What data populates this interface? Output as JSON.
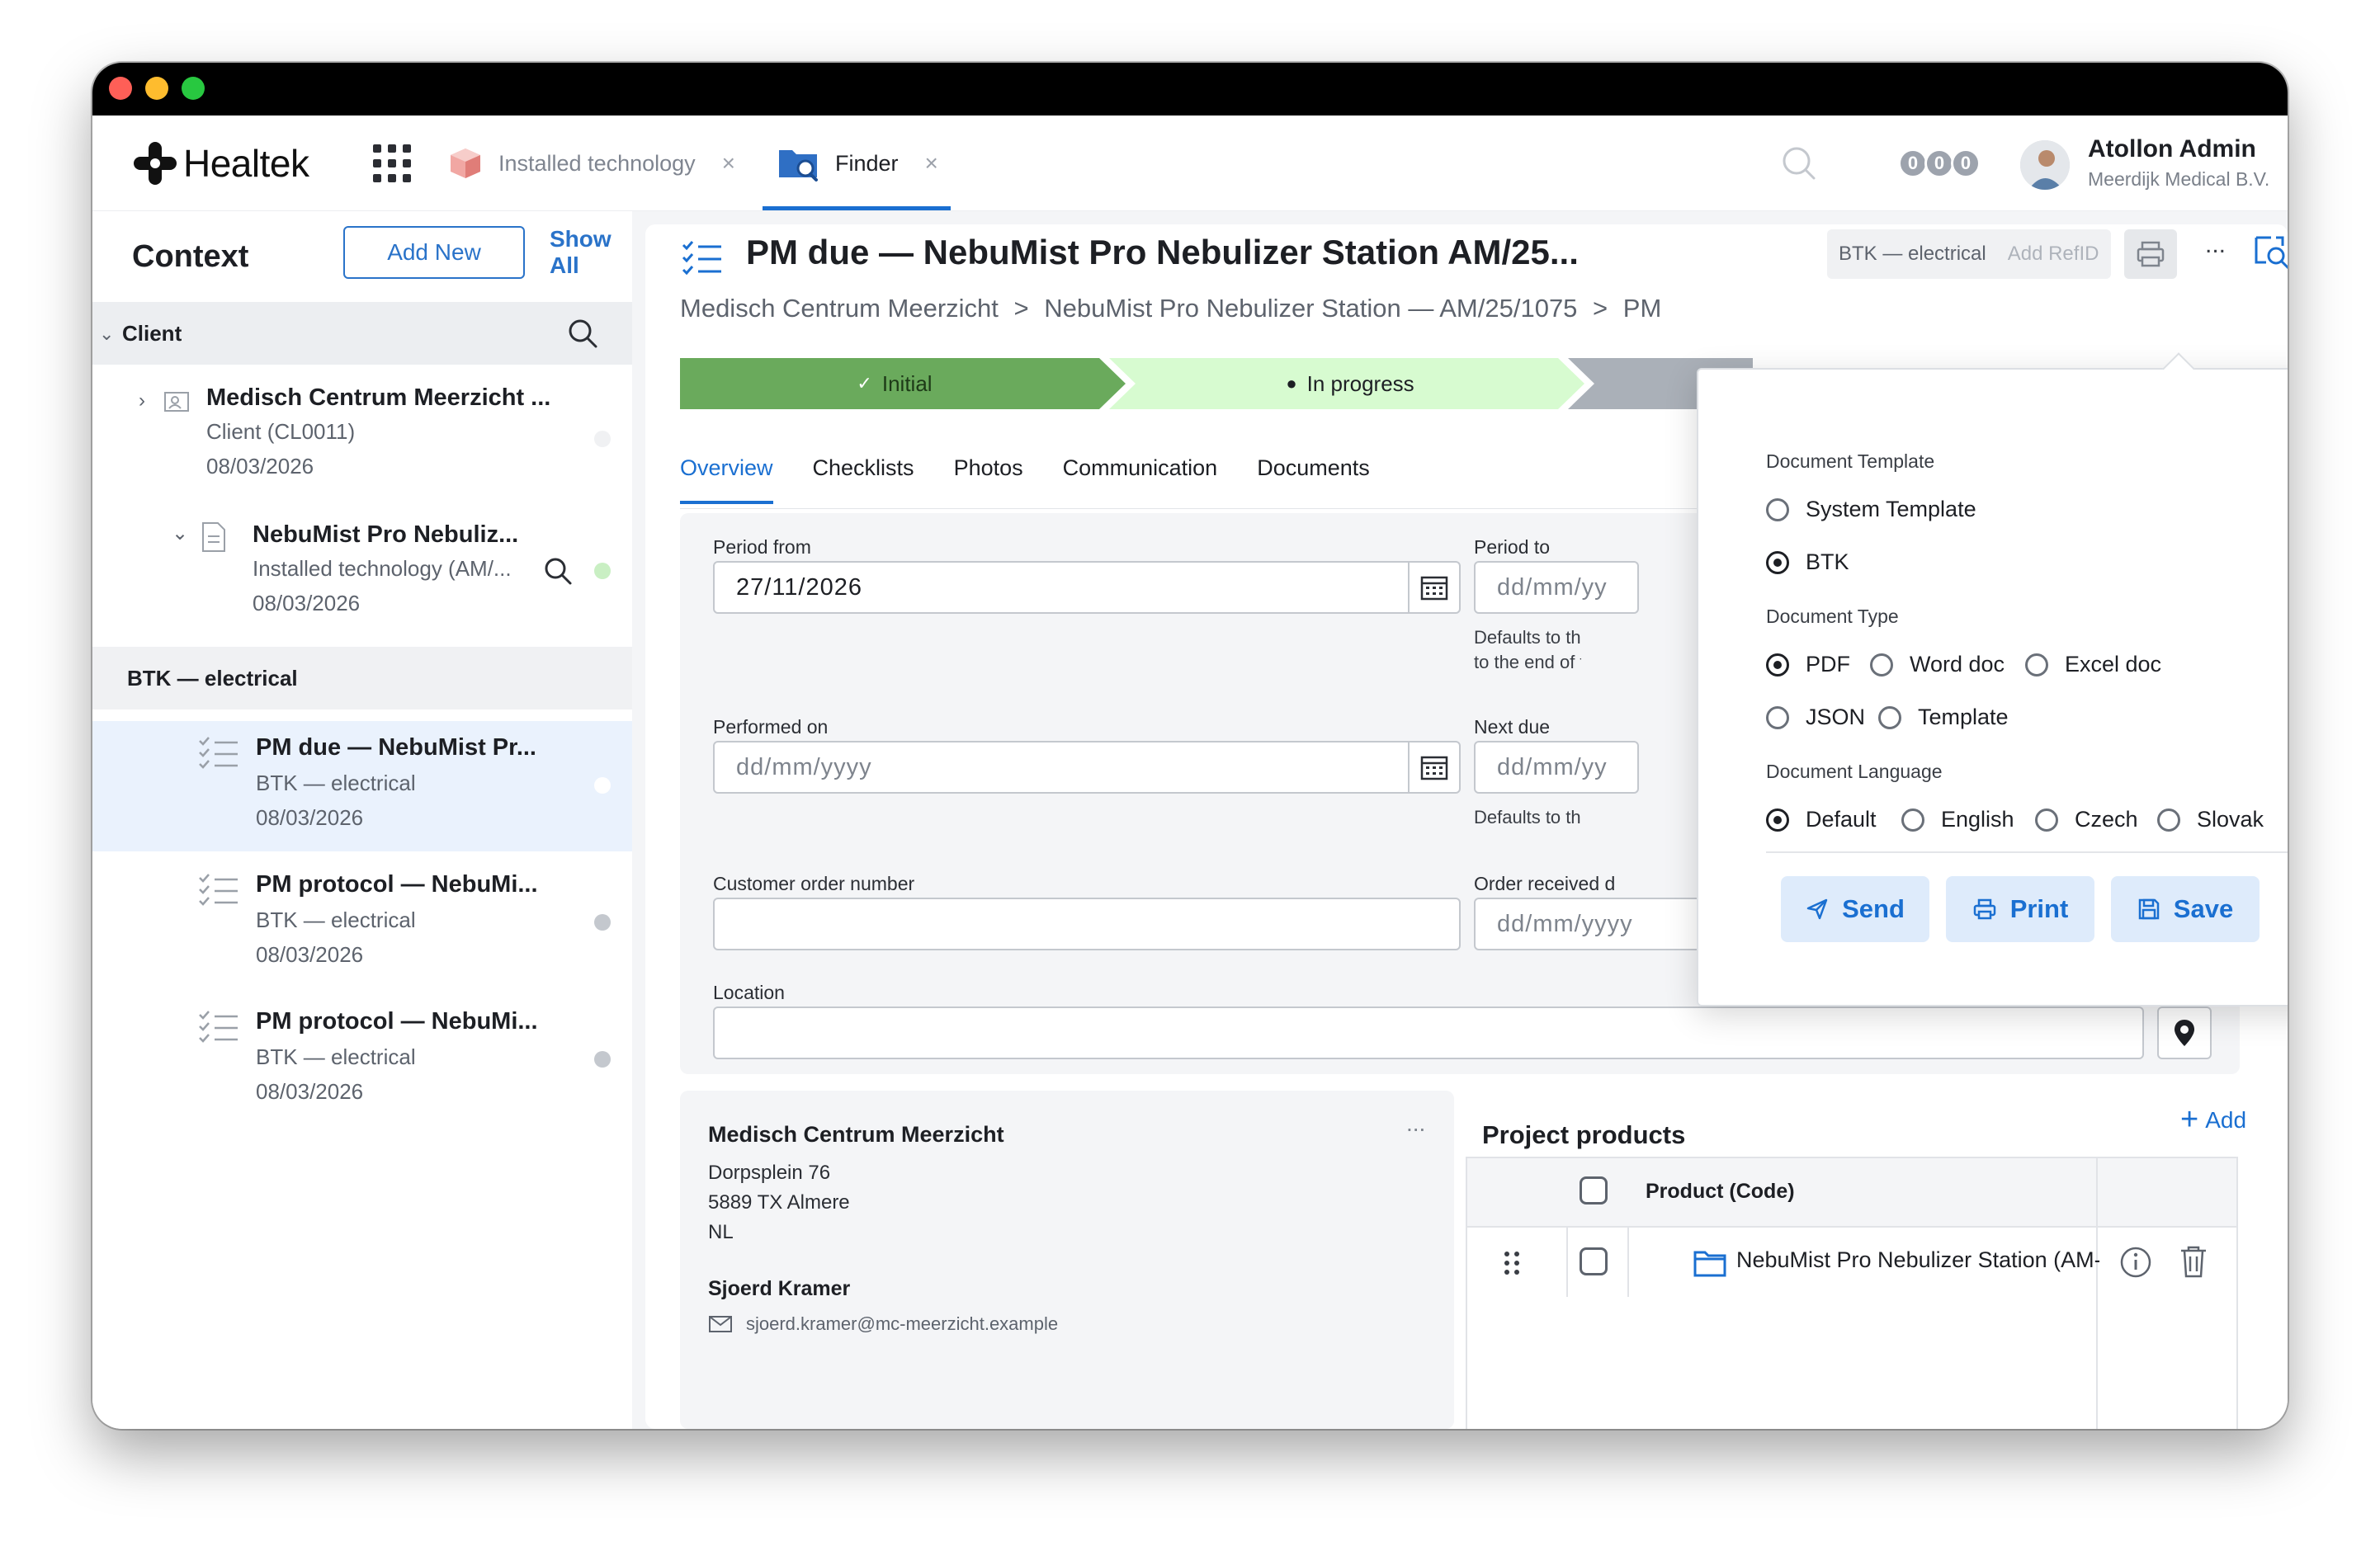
{
  "app": {
    "brand": "Healtek",
    "tabs": [
      {
        "label": "Installed technology",
        "close": "×"
      },
      {
        "label": "Finder",
        "close": "×"
      }
    ],
    "notification_badges": [
      "0",
      "0",
      "0"
    ],
    "user": {
      "name": "Atollon Admin",
      "org": "Meerdijk Medical B.V."
    }
  },
  "sidebar": {
    "title": "Context",
    "add_new": "Add New",
    "show_all": "Show All",
    "client_group": "Client",
    "client": {
      "title": "Medisch Centrum Meerzicht ...",
      "sub": "Client (CL0011)",
      "date": "08/03/2026"
    },
    "asset": {
      "title": "NebuMist Pro Nebuliz...",
      "sub": "Installed technology (AM/...",
      "date": "08/03/2026"
    },
    "btk_group": "BTK — electrical",
    "items": [
      {
        "title": "PM due — NebuMist Pr...",
        "sub": "BTK — electrical",
        "date": "08/03/2026"
      },
      {
        "title": "PM protocol — NebuMi...",
        "sub": "BTK — electrical",
        "date": "08/03/2026"
      },
      {
        "title": "PM protocol — NebuMi...",
        "sub": "BTK — electrical",
        "date": "08/03/2026"
      }
    ]
  },
  "main": {
    "title": "PM due — NebuMist Pro Nebulizer Station AM/25...",
    "tag": "BTK — electrical",
    "add_refid": "Add RefID",
    "more": "...",
    "breadcrumb": [
      "Medisch Centrum Meerzicht",
      ">",
      "NebuMist Pro Nebulizer Station — AM/25/1075",
      ">",
      "PM"
    ],
    "steps": [
      {
        "label": "Initial",
        "mark": "✓"
      },
      {
        "label": "In progress",
        "mark": "●"
      }
    ],
    "tabs": [
      "Overview",
      "Checklists",
      "Photos",
      "Communication",
      "Documents"
    ],
    "form": {
      "period_from_label": "Period from",
      "period_from_value": "27/11/2026",
      "period_to_label": "Period to",
      "period_to_placeholder": "dd/mm/yy",
      "period_to_hint_1": "Defaults to the pe",
      "period_to_hint_2": "to the end of that",
      "performed_on_label": "Performed on",
      "performed_on_placeholder": "dd/mm/yyyy",
      "next_due_label": "Next due",
      "next_due_placeholder": "dd/mm/yy",
      "next_due_hint": "Defaults to the pe",
      "customer_order_label": "Customer order number",
      "customer_order_value": "",
      "order_received_label": "Order received d",
      "order_received_placeholder": "dd/mm/yyyy",
      "location_label": "Location",
      "location_value": ""
    },
    "address": {
      "name": "Medisch Centrum Meerzicht",
      "line1": "Dorpsplein 76",
      "line2": "5889 TX Almere",
      "line3": "NL",
      "more": "...",
      "contact": "Sjoerd Kramer",
      "email": "sjoerd.kramer@mc-meerzicht.example"
    },
    "products": {
      "title": "Project products",
      "add": "Add",
      "column": "Product (Code)",
      "rows": [
        {
          "name": "NebuMist Pro Nebulizer Station (AM-N"
        }
      ]
    }
  },
  "popover": {
    "template_label": "Document Template",
    "templates": [
      {
        "label": "System Template",
        "selected": false
      },
      {
        "label": "BTK",
        "selected": true
      }
    ],
    "type_label": "Document Type",
    "types": [
      {
        "label": "PDF",
        "selected": true
      },
      {
        "label": "Word doc",
        "selected": false
      },
      {
        "label": "Excel doc",
        "selected": false
      },
      {
        "label": "JSON",
        "selected": false
      },
      {
        "label": "Template",
        "selected": false
      }
    ],
    "language_label": "Document Language",
    "languages": [
      {
        "label": "Default",
        "selected": true
      },
      {
        "label": "English",
        "selected": false
      },
      {
        "label": "Czech",
        "selected": false
      },
      {
        "label": "Slovak",
        "selected": false
      }
    ],
    "send": "Send",
    "print": "Print",
    "save": "Save"
  },
  "colors": {
    "accent": "#1a6fd1",
    "step_done": "#6aaa5c",
    "step_current": "#d7fbd0",
    "step_next": "#aab0b8",
    "status_green": "#c9efc3",
    "status_grey": "#c4c8ce"
  }
}
